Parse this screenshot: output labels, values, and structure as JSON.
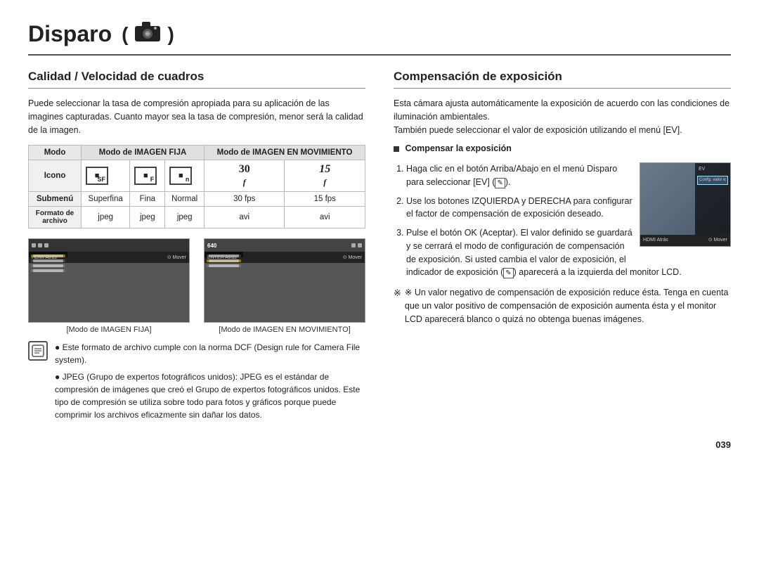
{
  "title": "Disparo",
  "camera_icon_label": "camera",
  "left_section": {
    "title": "Calidad / Velocidad de cuadros",
    "body": "Puede seleccionar la tasa de compresión apropiada para su aplicación de las imagines capturadas. Cuanto mayor sea la tasa de compresión, menor será la calidad de la imagen.",
    "table": {
      "col_headers": [
        "Modo",
        "Modo de IMAGEN FIJA",
        "",
        "Modo de IMAGEN EN MOVIMIENTO",
        ""
      ],
      "rows": [
        {
          "label": "Modo",
          "cells": [
            "Modo de IMAGEN FIJA",
            "",
            "Modo de IMAGEN EN MOVIMIENTO",
            ""
          ]
        },
        {
          "label": "Icono",
          "icons": [
            "SF",
            "F",
            "n",
            "30",
            "15"
          ]
        },
        {
          "label": "Submenú",
          "cells": [
            "Superfina",
            "Fina",
            "Normal",
            "30 fps",
            "15 fps"
          ]
        },
        {
          "label": "Formato de archivo",
          "cells": [
            "jpeg",
            "jpeg",
            "jpeg",
            "avi",
            "avi"
          ]
        }
      ]
    },
    "screenshots": [
      {
        "caption": "[Modo de IMAGEN FIJA]",
        "label": "screenshot-still-mode"
      },
      {
        "caption": "[Modo de IMAGEN EN MOVIMIENTO]",
        "label": "screenshot-motion-mode"
      }
    ],
    "note_icon": "✎",
    "notes": [
      "Este formato de archivo cumple con la norma DCF (Design rule for Camera File system).",
      "JPEG (Grupo de expertos fotográficos unidos): JPEG es el estándar de compresión de imágenes que creó el Grupo de expertos fotográficos unidos. Este tipo de compresión se utiliza sobre todo para fotos y gráficos porque puede comprimir los archivos eficazmente sin dañar los datos."
    ]
  },
  "right_section": {
    "title": "Compensación de exposición",
    "intro": "Esta cámara ajusta automáticamente la exposición de acuerdo con las condiciones de iluminación ambientales.\nTambién puede seleccionar el valor de exposición utilizando el menú [EV].",
    "bullet_title": "Compensar la exposición",
    "steps": [
      "Haga clic en el botón Arriba/Abajo en el menú Disparo para seleccionar [EV] ( ✎ ).",
      "Use los botones IZQUIERDA y DERECHA para configurar el factor de compensación de exposición deseado.",
      "Pulse el botón OK (Aceptar). El valor definido se guardará y se cerrará el modo de configuración de compensación de exposición. Si usted cambia el valor de exposición, el indicador de exposición ( ✎ ) aparecerá a la izquierda del monitor LCD."
    ],
    "ev_menu_items": [
      "EV",
      "Confg. valor exposicion para aj. brillo",
      "Atrás",
      "Mover"
    ],
    "note_star": "※ Un valor negativo de compensación de exposición reduce ésta. Tenga en cuenta que un valor positivo de compensación de exposición aumenta ésta y el monitor LCD aparecerá blanco o quizá no obtenga buenas imágenes."
  },
  "page_number": "039"
}
